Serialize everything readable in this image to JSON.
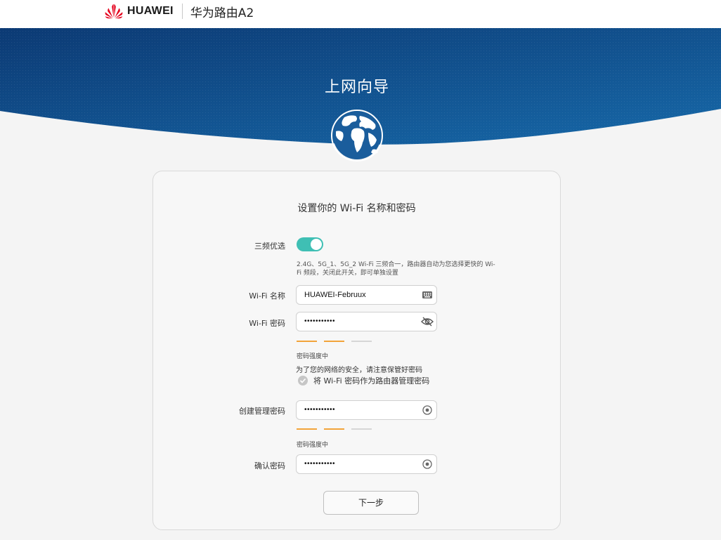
{
  "header": {
    "brand": "HUAWEI",
    "product": "华为路由A2",
    "logo_icon": "huawei-flower-logo",
    "logo_color": "#e4001c"
  },
  "banner": {
    "title": "上网向导",
    "icon": "globe-icon",
    "gradient_top": "#0c3b78",
    "gradient_bottom": "#1668a8"
  },
  "form": {
    "title": "设置你的 Wi-Fi 名称和密码",
    "tri_band": {
      "label": "三频优选",
      "enabled": true,
      "toggle_color": "#3fbfb4",
      "hint_line1": "2.4G、5G_1、5G_2 Wi-Fi 三频合一，路由器自动为您选择更快的 Wi-",
      "hint_line2": "Fi 频段，关闭此开关，即可单独设置"
    },
    "wifi_name": {
      "label": "Wi-Fi 名称",
      "value": "HUAWEI-Februux",
      "icon": "keyboard-icon"
    },
    "wifi_password": {
      "label": "Wi-Fi 密码",
      "value": "•••••••••••",
      "icon": "eye-slash-icon",
      "strength_text": "密码强度中",
      "strength_level": 2,
      "strength_max": 3
    },
    "security_note": "为了您的网络的安全，请注意保管好密码",
    "reuse_checkbox": {
      "label": "将 Wi-Fi 密码作为路由器管理密码",
      "checked": false
    },
    "admin_password": {
      "label": "创建管理密码",
      "value": "•••••••••••",
      "icon": "eye-icon",
      "strength_text": "密码强度中",
      "strength_level": 2,
      "strength_max": 3
    },
    "confirm_password": {
      "label": "确认密码",
      "value": "•••••••••••",
      "icon": "eye-icon"
    },
    "next_button": "下一步",
    "strength_color": "#f2a43a"
  }
}
